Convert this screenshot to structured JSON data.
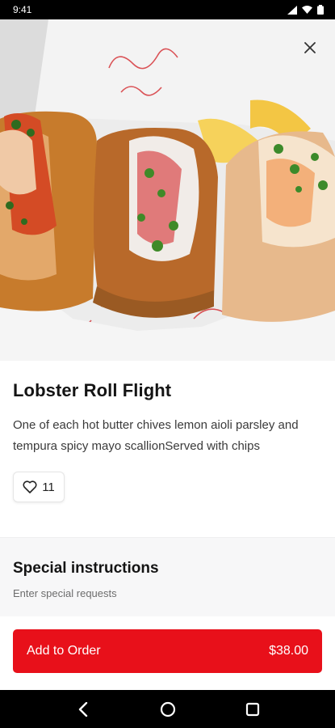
{
  "status_bar": {
    "time": "9:41",
    "icons": [
      "signal-icon",
      "wifi-icon",
      "battery-icon"
    ]
  },
  "hero": {
    "close_icon": "close-icon"
  },
  "item": {
    "title": "Lobster Roll Flight",
    "description": "One of each hot butter chives lemon aioli parsley and tempura spicy mayo scallionServed with chips",
    "likes": "11",
    "like_icon": "heart-outline-icon"
  },
  "special_instructions": {
    "title": "Special instructions",
    "placeholder": "Enter special requests",
    "value": ""
  },
  "cta": {
    "label": "Add to Order",
    "price": "$38.00"
  },
  "nav_bar": {
    "icons": [
      "back-icon",
      "home-icon",
      "recents-icon"
    ]
  },
  "colors": {
    "accent": "#e8101a",
    "title_text": "#141414",
    "body_text": "#3a3a3a",
    "section_bg": "#f7f7f8"
  }
}
